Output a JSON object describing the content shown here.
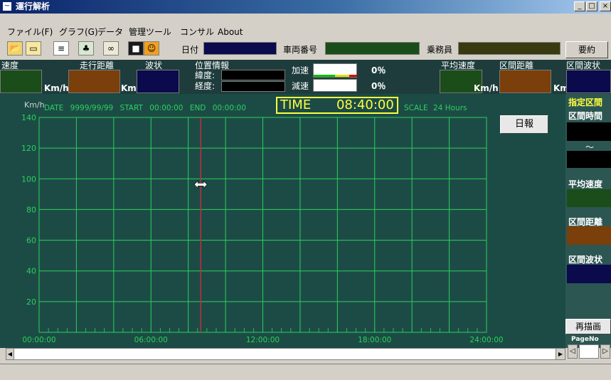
{
  "window": {
    "title": "運行解析",
    "icon": "app-chart-icon",
    "minimize": "_",
    "maximize": "□",
    "close": "×"
  },
  "menu": [
    {
      "label": "ファイル(F)"
    },
    {
      "label": "グラフ(G)"
    },
    {
      "label": "データ"
    },
    {
      "label": "管理ツール"
    },
    {
      "label": "コンサル"
    },
    {
      "label": "About"
    }
  ],
  "toolbar": {
    "icons": [
      "open-folder-icon",
      "folder-icon",
      "document-icon",
      "people-icon",
      "binoculars-icon",
      "save-icon",
      "user-icon"
    ],
    "date_label": "日付",
    "vehicle_label": "車両番号",
    "crew_label": "乗務員",
    "summary_button": "要約"
  },
  "info": {
    "speed": {
      "label": "速度",
      "unit": "Km/h"
    },
    "distance": {
      "label": "走行距離",
      "unit": "Km"
    },
    "waveform": {
      "label": "波状"
    },
    "position": {
      "label": "位置情報",
      "lat": "緯度:",
      "lon": "経度:"
    },
    "accel": {
      "label": "加速",
      "value": "0％"
    },
    "decel": {
      "label": "減速",
      "value": "0％"
    },
    "avg_speed": {
      "label": "平均速度",
      "unit": "Km/h"
    },
    "section_distance": {
      "label": "区間距離",
      "unit": "Km"
    },
    "section_wave": {
      "label": "区間波状"
    }
  },
  "chart_header": {
    "unit": "Km/h",
    "date_label": "DATE",
    "date_value": "9999/99/99",
    "start_label": "START",
    "start_value": "00:00:00",
    "end_label": "END",
    "end_value": "00:00:00",
    "time_label": "TIME",
    "time_value": "08:40:00",
    "scale_label": "SCALE",
    "scale_value": "24 Hours",
    "daily_report_button": "日報"
  },
  "chart_data": {
    "type": "line",
    "xlabel": "",
    "ylabel": "Km/h",
    "ylim": [
      0,
      140
    ],
    "y_ticks": [
      "140",
      "120",
      "100",
      "80",
      "60",
      "40",
      "20"
    ],
    "x_ticks": [
      "00:00:00",
      "06:00:00",
      "12:00:00",
      "18:00:00",
      "24:00:00"
    ],
    "xlim_hours": [
      0,
      24
    ],
    "cursor_time": "08:40:00",
    "cursor_hours": 8.6667,
    "grid": true,
    "series": []
  },
  "sidepanel": {
    "specified_section": "指定区間",
    "section_time": "区間時間",
    "tilde": "～",
    "avg_speed": "平均速度",
    "section_distance": "区間距離",
    "section_wave": "区間波状",
    "redraw_button": "再描画",
    "page_no": "PageNo"
  },
  "colors": {
    "chart_bg": "#1c4b46",
    "grid": "#2bd15a",
    "cursor": "#c0303a",
    "time_text": "#ffff40",
    "green_box": "#1a4d1a",
    "brown_box": "#7a3f0a",
    "navy_box": "#0a0a4d"
  }
}
